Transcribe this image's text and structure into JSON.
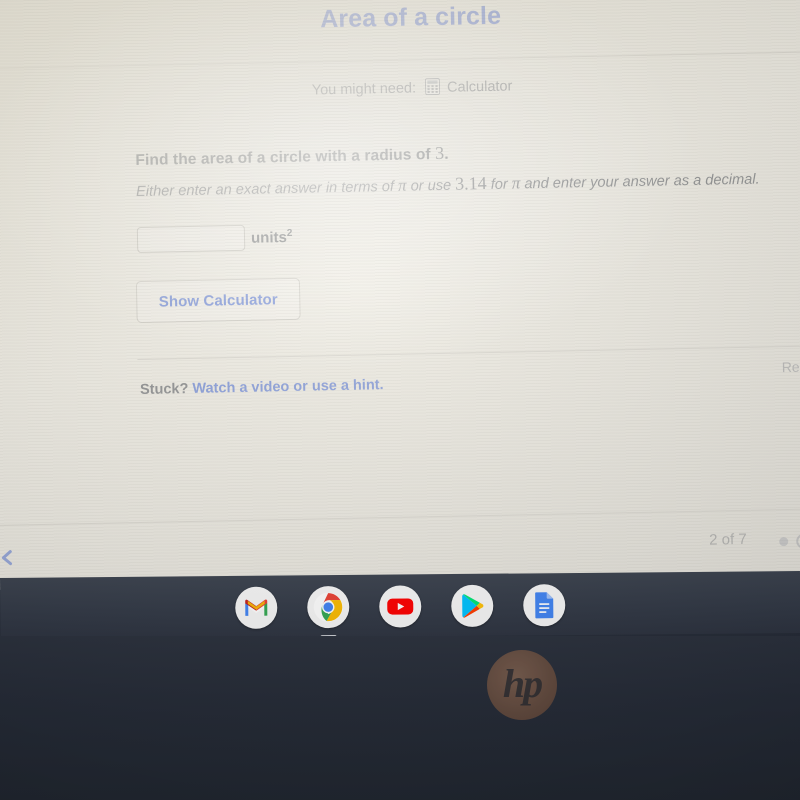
{
  "exercise": {
    "title": "Area of a circle",
    "need_label": "You might need:",
    "calculator_label": "Calculator",
    "calculator_icon": "calculator-icon",
    "prompt_prefix": "Find the area of a circle with a radius of ",
    "prompt_value": "3",
    "prompt_suffix": ".",
    "instruction_part1": "Either enter an exact answer in terms of ",
    "instruction_pi1": "π",
    "instruction_part2": " or use ",
    "instruction_value": "3.14",
    "instruction_part3": " for ",
    "instruction_pi2": "π",
    "instruction_part4": " and enter your answer as a decimal."
  },
  "answer": {
    "value": "",
    "placeholder": "",
    "units_label": "units",
    "units_exponent": "2"
  },
  "buttons": {
    "show_calculator": "Show Calculator"
  },
  "help": {
    "stuck_label": "Stuck?",
    "hint_link": "Watch a video or use a hint.",
    "report_link": "Report a problem"
  },
  "footer": {
    "page_count": "2 of 7",
    "dots": [
      "filled",
      "hollow"
    ]
  },
  "shelf": {
    "items": [
      {
        "name": "gmail-icon",
        "label": "Gmail",
        "active": false
      },
      {
        "name": "chrome-icon",
        "label": "Chrome",
        "active": true
      },
      {
        "name": "youtube-icon",
        "label": "YouTube",
        "active": false
      },
      {
        "name": "play-store-icon",
        "label": "Play Store",
        "active": false
      },
      {
        "name": "google-docs-icon",
        "label": "Docs",
        "active": false
      }
    ]
  },
  "device": {
    "brand": "hp"
  },
  "colors": {
    "link_blue": "#2f57cc",
    "title_blue": "#2b4ec7",
    "page_background": "#ece9de",
    "shelf": "#333a47",
    "lid": "#262c38"
  }
}
